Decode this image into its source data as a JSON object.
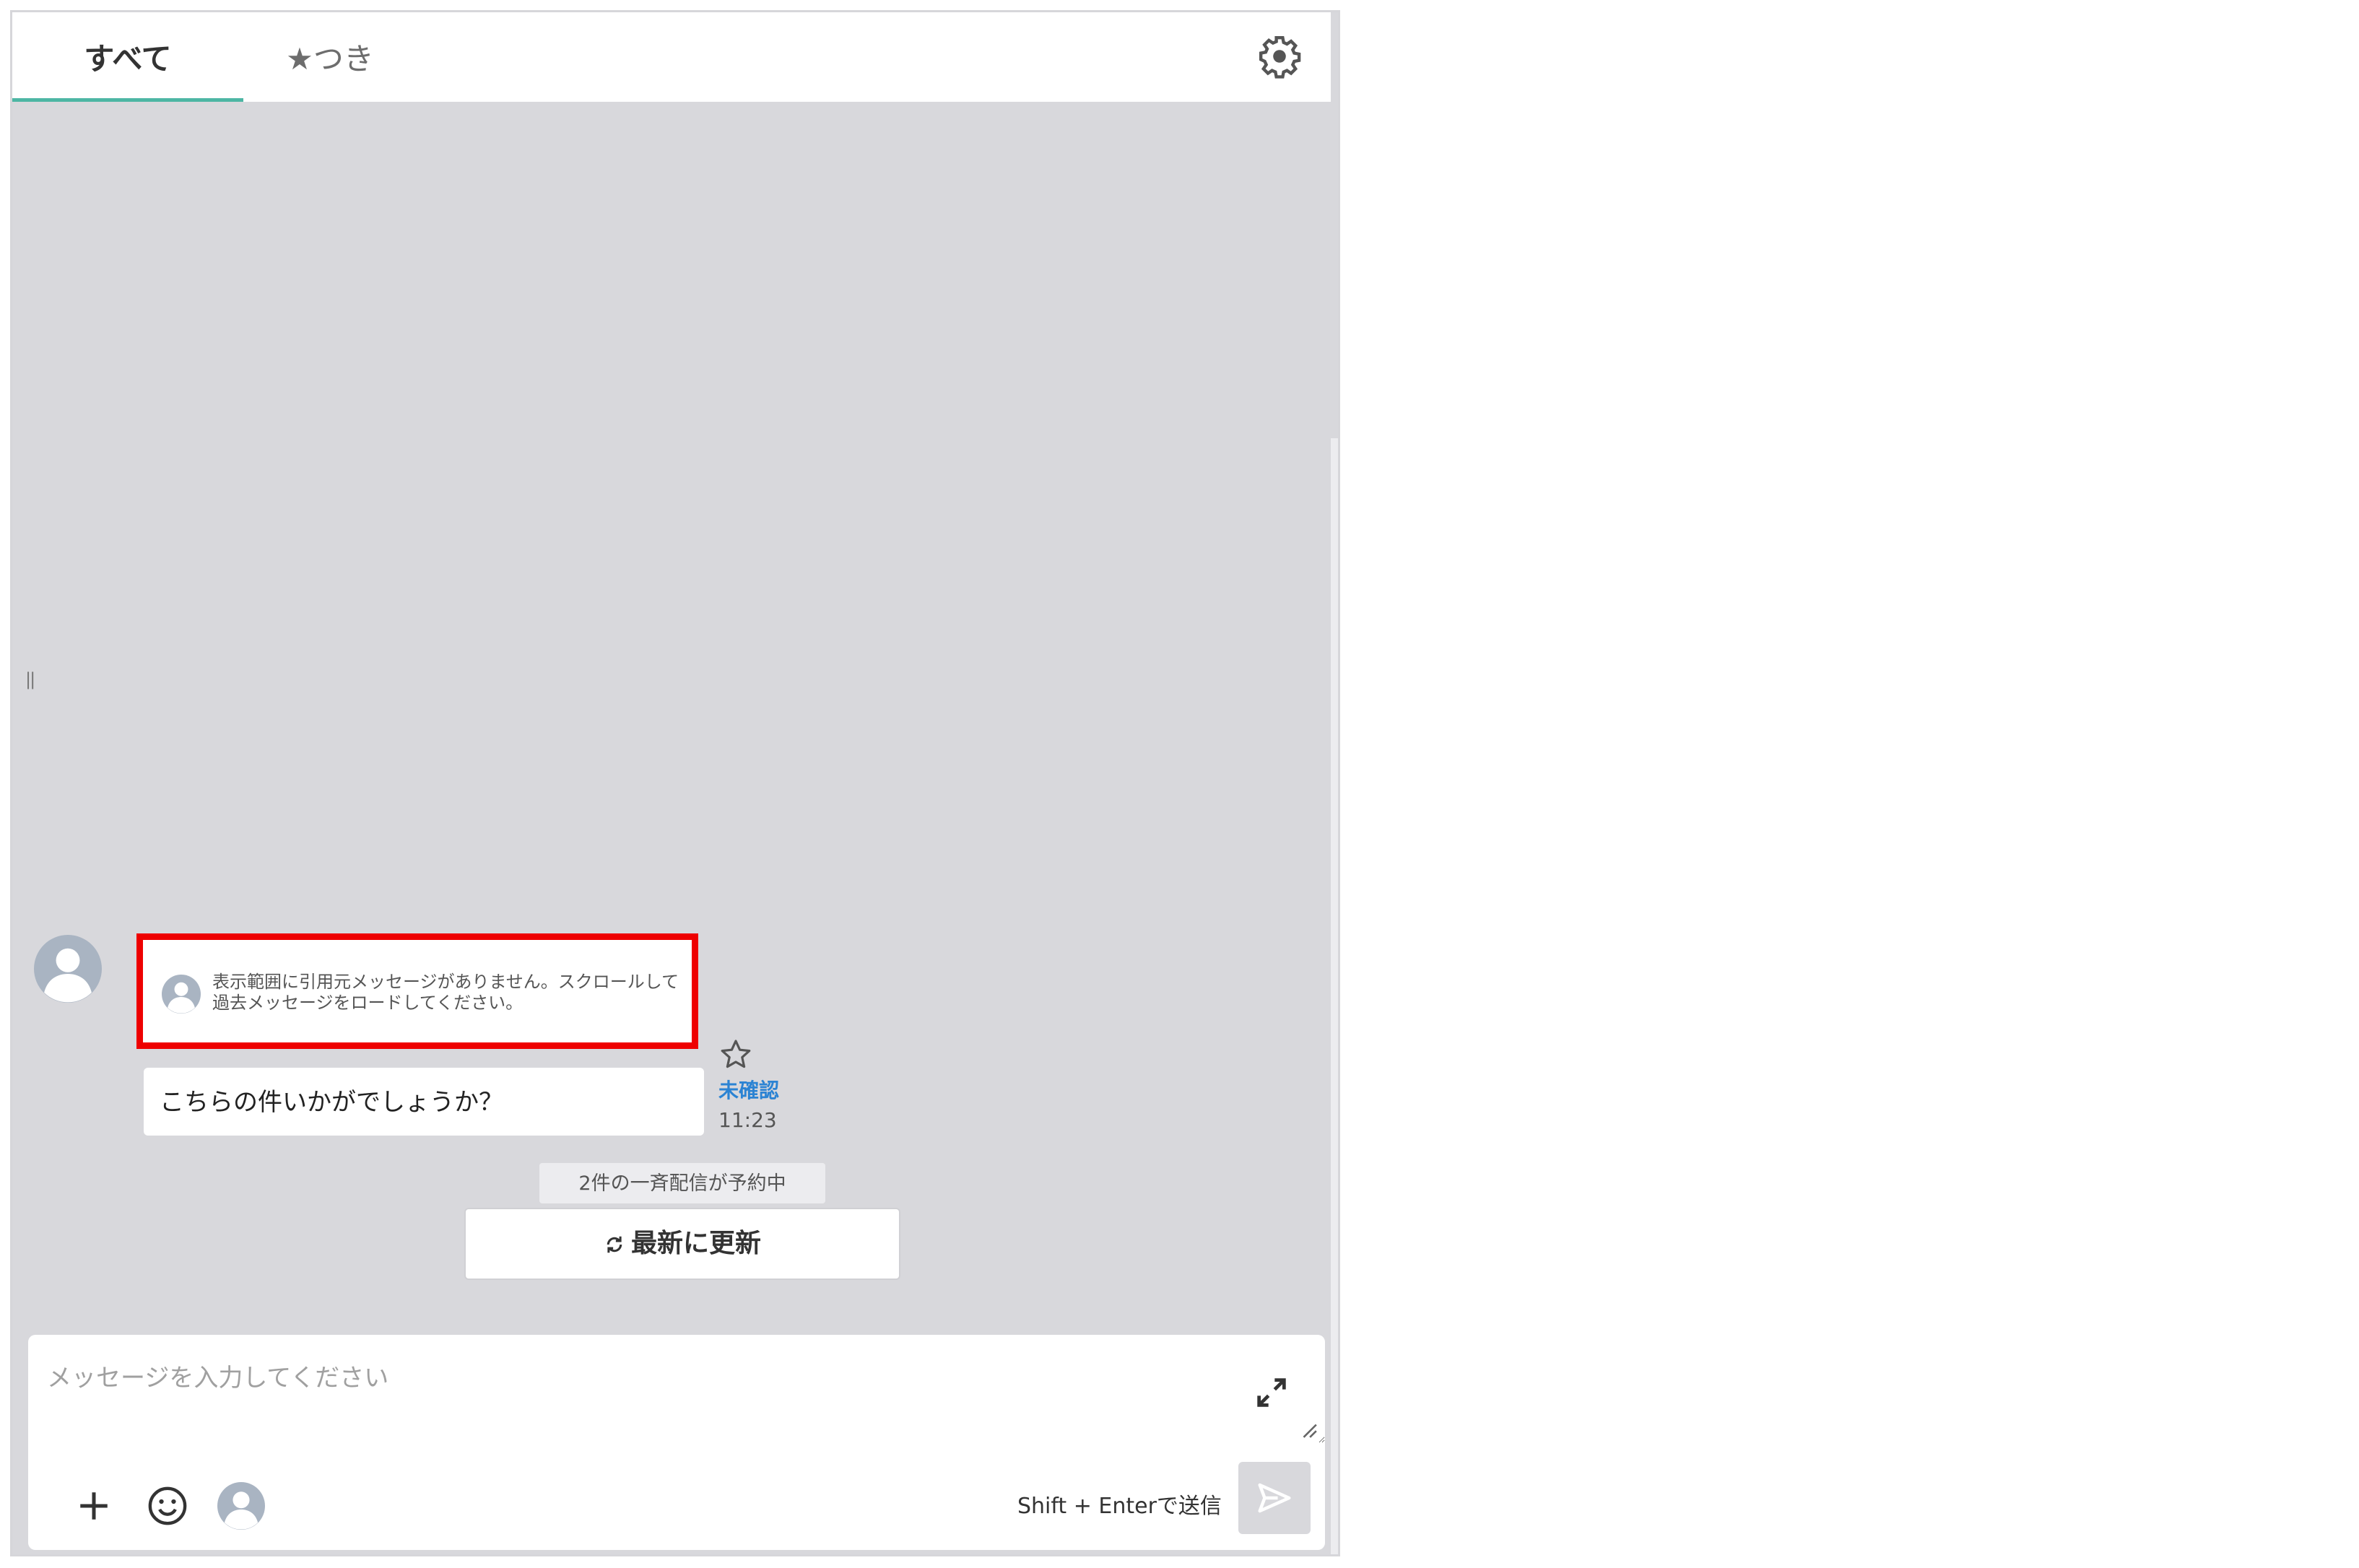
{
  "tabs": [
    {
      "label": "すべて",
      "active": true
    },
    {
      "label": "★つき",
      "active": false
    }
  ],
  "colors": {
    "accent": "#4db6a4",
    "highlight_border": "#ee0000",
    "unread_label": "#2b83d3",
    "chat_background": "#d8d8dc"
  },
  "message": {
    "quote_notice": "表示範囲に引用元メッセージがありません。スクロールして過去メッセージをロードしてください。",
    "text": "こちらの件いかがでしょうか？",
    "status": "未確認",
    "time": "11:23"
  },
  "broadcast": {
    "notice": "2件の一斉配信が予約中",
    "refresh_label": "最新に更新"
  },
  "composer": {
    "placeholder": "メッセージを入力してください",
    "shift_hint": "Shift + Enterで送信"
  },
  "icons": {
    "settings": "gear-icon",
    "star": "star-outline-icon",
    "refresh": "refresh-icon",
    "expand": "expand-icon",
    "add": "plus-icon",
    "emoji": "smiley-icon",
    "mention": "avatar-icon",
    "send": "send-icon"
  }
}
